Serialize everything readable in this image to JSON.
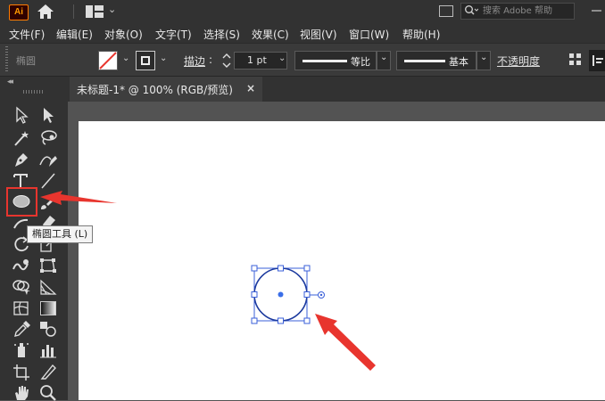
{
  "app": {
    "logo": "Ai"
  },
  "titlebar": {
    "search_placeholder": "搜索 Adobe 帮助"
  },
  "menu": [
    "文件(F)",
    "编辑(E)",
    "对象(O)",
    "文字(T)",
    "选择(S)",
    "效果(C)",
    "视图(V)",
    "窗口(W)",
    "帮助(H)"
  ],
  "control_bar": {
    "object_label": "椭圆",
    "stroke_label": "描边",
    "stroke_value": "1 pt",
    "profile_label": "等比",
    "brush_label": "基本",
    "opacity_label": "不透明度"
  },
  "document": {
    "tab_title": "未标题-1* @ 100% (RGB/预览)",
    "close_symbol": "×"
  },
  "tooltip": {
    "text": "椭圆工具 (L)"
  },
  "colors": {
    "accent": "#ff7c00",
    "highlight_red": "#e8352e",
    "selection_blue": "#3a5fd8",
    "panel_dark": "#323232",
    "artboard": "#ffffff"
  },
  "tools": [
    "selection-tool",
    "direct-selection-tool",
    "magic-wand-tool",
    "lasso-tool",
    "pen-tool",
    "curvature-tool",
    "type-tool",
    "line-segment-tool",
    "ellipse-tool",
    "paintbrush-tool",
    "shaper-tool",
    "eraser-tool",
    "rotate-tool",
    "scale-tool",
    "warp-tool",
    "free-transform-tool",
    "shape-builder-tool",
    "perspective-grid-tool",
    "mesh-tool",
    "gradient-tool",
    "eyedropper-tool",
    "blend-tool",
    "symbol-sprayer-tool",
    "column-graph-tool",
    "artboard-tool",
    "slice-tool",
    "hand-tool",
    "zoom-tool"
  ]
}
